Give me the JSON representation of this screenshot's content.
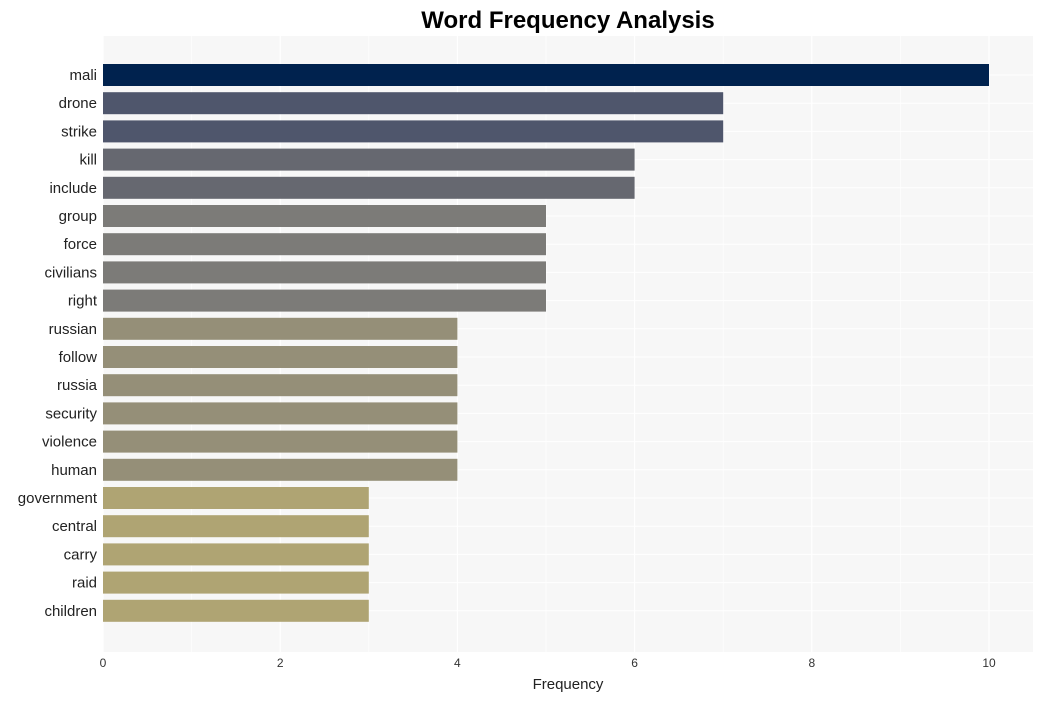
{
  "chart_data": {
    "type": "bar",
    "orientation": "horizontal",
    "title": "Word Frequency Analysis",
    "xlabel": "Frequency",
    "ylabel": "",
    "xlim": [
      0,
      10.5
    ],
    "xticks": [
      0,
      2,
      4,
      6,
      8,
      10
    ],
    "grid": true,
    "legend": "none",
    "categories": [
      "mali",
      "drone",
      "strike",
      "kill",
      "include",
      "group",
      "force",
      "civilians",
      "right",
      "russian",
      "follow",
      "russia",
      "security",
      "violence",
      "human",
      "government",
      "central",
      "carry",
      "raid",
      "children"
    ],
    "values": [
      10,
      7,
      7,
      6,
      6,
      5,
      5,
      5,
      5,
      4,
      4,
      4,
      4,
      4,
      4,
      3,
      3,
      3,
      3,
      3
    ],
    "colors_by_value": {
      "10": "#00224e",
      "7": "#4f566c",
      "6": "#666870",
      "5": "#7c7b78",
      "4": "#958f78",
      "3": "#afa473"
    },
    "background": "#f7f7f7",
    "grid_color": "#ffffff"
  }
}
